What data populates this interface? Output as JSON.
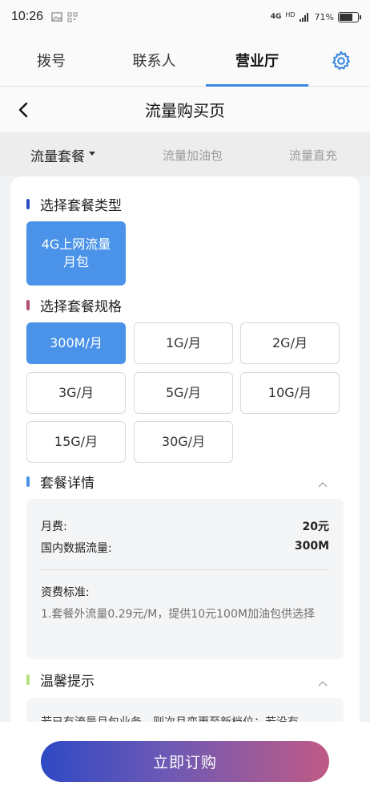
{
  "status": {
    "time": "10:26",
    "network": "4G",
    "hd": "HD",
    "battery": "71%",
    "battery_level": 0.71
  },
  "tabs": [
    {
      "label": "拨号"
    },
    {
      "label": "联系人"
    },
    {
      "label": "营业厅",
      "active": true
    }
  ],
  "header": {
    "title": "流量购买页"
  },
  "categories": [
    {
      "label": "流量套餐",
      "active": true
    },
    {
      "label": "流量加油包"
    },
    {
      "label": "流量直充"
    }
  ],
  "sections": {
    "type": {
      "title": "选择套餐类型",
      "color": "#2b4ec2",
      "options": [
        {
          "line1": "4G上网流量",
          "line2": "月包",
          "selected": true
        }
      ]
    },
    "spec": {
      "title": "选择套餐规格",
      "color": "#b5506e",
      "options": [
        {
          "label": "300M/月",
          "selected": true
        },
        {
          "label": "1G/月"
        },
        {
          "label": "2G/月"
        },
        {
          "label": "3G/月"
        },
        {
          "label": "5G/月"
        },
        {
          "label": "10G/月"
        },
        {
          "label": "15G/月"
        },
        {
          "label": "30G/月"
        }
      ]
    },
    "detail": {
      "title": "套餐详情",
      "color": "#4a93e8",
      "monthly_fee_label": "月费:",
      "monthly_fee_value": "20元",
      "data_label": "国内数据流量:",
      "data_value": "300M",
      "fee_standard_label": "资费标准:",
      "fee_standard_text": "1.套餐外流量0.29元/M，提供10元100M加油包供选择"
    },
    "tips": {
      "title": "温馨提示",
      "color": "#b4df7c",
      "text": "若已有流量月包业务，则次月变更至新档位；若没有"
    }
  },
  "buy_button": {
    "label": "立即订购"
  }
}
